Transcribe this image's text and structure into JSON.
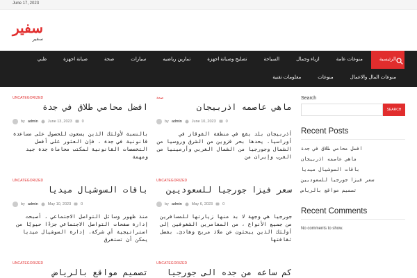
{
  "topbar": {
    "date": "June 17, 2023"
  },
  "brand": {
    "logo": "سفير",
    "tagline": "سفير"
  },
  "nav": {
    "row1": [
      "الرئيسية",
      "منوعات عامة",
      "ازياء وجمال",
      "السياحة",
      "تصليح وصيانة اجهزة",
      "تمارين رياضيه",
      "سيارات",
      "صحة",
      "صيانة اجهزة",
      "طبي"
    ],
    "row2": [
      "منوعات المال والاعمال",
      "منوعات",
      "معلومات تقنية"
    ],
    "active": "الرئيسية"
  },
  "posts": [
    {
      "category": "UNCATEGORIZED",
      "title": "افضل محامي طلاق في جدة",
      "author": "admin",
      "date": "June 13, 2023",
      "comments": "0",
      "excerpt": "بالنسبة لأولئك الذين يسعون للحصول على مساعدة قانونية في جدة ، فإن العثور على أفضل التخصصات القانونية لمكتب محاماة جدة جيد ومهمة"
    },
    {
      "category": "صحة",
      "title": "ماهي عاصمه اذربيجان",
      "author": "admin",
      "date": "June 10, 2023",
      "comments": "0",
      "excerpt": "أذربيجان بلد يقع في منطقة القوقاز في أوراسيا. يحدها بحر قزوين من الشرق وروسيا من الشمال وجورجيا من الشمال الغربي وأرمينيا من الغرب وإيران من"
    },
    {
      "category": "UNCATEGORIZED",
      "title": "باقات السوشيال ميديا",
      "author": "admin",
      "date": "May 10, 2023",
      "comments": "0",
      "excerpt": "منذ ظهور وسائل التواصل الاجتماعي ، أصبحت إدارة صفحات التواصل الاجتماعي جزءًا حيويًا من استراتيجية أي شركة. إدارة السوشيال ميديا يمكن أن تستغرق"
    },
    {
      "category": "UNCATEGORIZED",
      "title": "سعر فيزا جورجيا للسعوديين",
      "author": "admin",
      "date": "May 6, 2023",
      "comments": "0",
      "excerpt": "جورجيا هي وجهة لا بد منها زيارتها للمسافرين من جميع الأنواع ، من المغامرين الشغوفين إلى أولئك الذين يبحثون عن ملاذ مريح وهادئ. بفضل ثقافتها"
    },
    {
      "category": "UNCATEGORIZED",
      "title": "تصميم مواقع بالرياض",
      "author": "",
      "date": "",
      "comments": "",
      "excerpt": ""
    },
    {
      "category": "UNCATEGORIZED",
      "title": "كم ساعه من جده الى جورجيا",
      "author": "",
      "date": "",
      "comments": "",
      "excerpt": ""
    }
  ],
  "sidebar": {
    "search_label": "Search",
    "search_button": "SEARCH",
    "search_value": "",
    "recent_posts_title": "Recent Posts",
    "recent_posts": [
      "افضل محامي طلاق في جدة",
      "ماهي عاصمه اذربيجان",
      "باقات السوشيال ميديا",
      "سعر فيزا جورجيا للسعوديين",
      "تصميم مواقع بالرياض"
    ],
    "recent_comments_title": "Recent Comments",
    "no_comments": "No comments to show."
  },
  "colors": {
    "accent": "#e12d2d",
    "nav_bg": "#1f1f1f",
    "topbar_bg": "#f5f5f5"
  },
  "icons": {
    "search": "search-icon",
    "clock": "clock-icon",
    "comment": "comment-icon",
    "avatar": "avatar"
  }
}
